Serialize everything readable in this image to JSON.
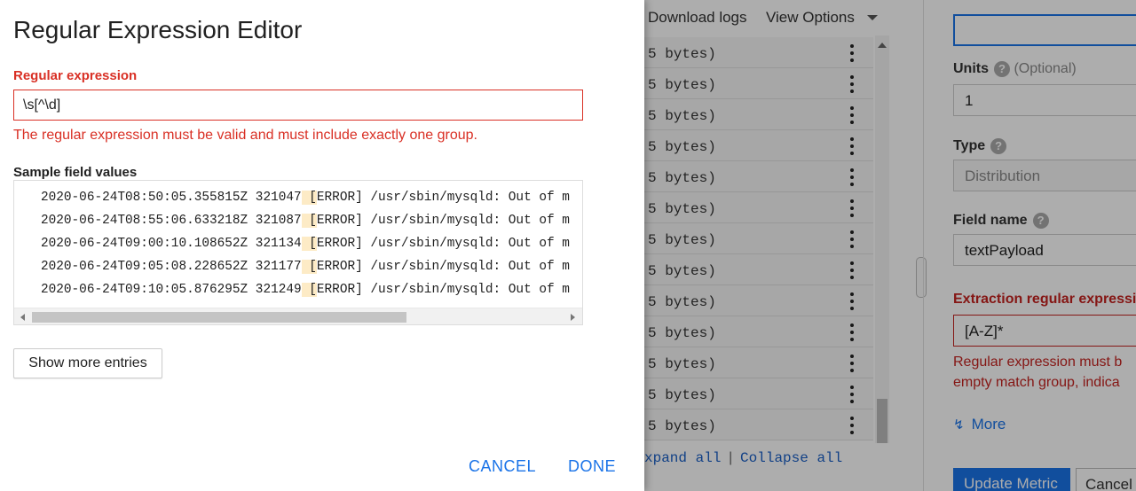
{
  "dialog": {
    "title": "Regular Expression Editor",
    "regex_label": "Regular expression",
    "regex_value": "\\s[^\\d]",
    "error": "The regular expression must be valid and must include exactly one group.",
    "sample_label": "Sample field values",
    "sample_lines": [
      {
        "pre": "2020-06-24T08:50:05.355815Z 321047",
        "hl": " [",
        "post": "ERROR] /usr/sbin/mysqld: Out of m"
      },
      {
        "pre": "2020-06-24T08:55:06.633218Z 321087",
        "hl": " [",
        "post": "ERROR] /usr/sbin/mysqld: Out of m"
      },
      {
        "pre": "2020-06-24T09:00:10.108652Z 321134",
        "hl": " [",
        "post": "ERROR] /usr/sbin/mysqld: Out of m"
      },
      {
        "pre": "2020-06-24T09:05:08.228652Z 321177",
        "hl": " [",
        "post": "ERROR] /usr/sbin/mysqld: Out of m"
      },
      {
        "pre": "2020-06-24T09:10:05.876295Z 321249",
        "hl": " [",
        "post": "ERROR] /usr/sbin/mysqld: Out of m"
      }
    ],
    "show_more": "Show more entries",
    "cancel": "CANCEL",
    "done": "DONE"
  },
  "background": {
    "download_logs": "Download logs",
    "view_options": "View Options",
    "log_row_text": "5 bytes)",
    "expand_all": "xpand all",
    "separator": "|",
    "collapse_all": "Collapse all",
    "units_label": "Units",
    "units_optional": "(Optional)",
    "units_value": "1",
    "type_label": "Type",
    "type_value": "Distribution",
    "field_name_label": "Field name",
    "field_name_value": "textPayload",
    "extraction_label": "Extraction regular expression",
    "extraction_value": "[A-Z]*",
    "extraction_error_1": "Regular expression must b",
    "extraction_error_2": "empty match group, indica",
    "more": "More",
    "update_metric": "Update Metric",
    "cancel": "Cancel"
  },
  "colors": {
    "accent": "#1a73e8",
    "error": "#d93025",
    "highlight": "#fdebc6"
  }
}
